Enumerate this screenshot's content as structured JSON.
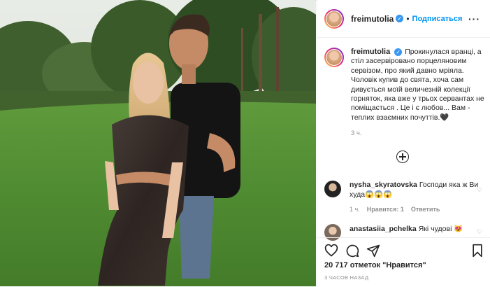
{
  "post": {
    "username": "freimutolia",
    "verified_glyph": "✓",
    "follow_label": "Подписаться",
    "more_label": "···",
    "caption": "Прокинулася вранці, а стіл засервіровано порцеляновим сервізом, про який давно мріяла. Чоловік купив до свята, хоча сам дивується моїй величезній колекції горняток, яка вже у трьох сервантах не поміщається . Це і є любов... Вам - теплих взаємних почуттів.🖤",
    "caption_time": "3 ч.",
    "load_more_icon": "plus-circle-icon"
  },
  "comments": [
    {
      "username": "nysha_skyratovska",
      "text": "Господи яка ж Ви худа😱😱😱",
      "time": "1 ч.",
      "likes": "Нравится: 1",
      "reply": "Ответить"
    },
    {
      "username": "anastasiia_pchelka",
      "text": "Які чудові 😻"
    }
  ],
  "actions": {
    "icons": [
      "heart-icon",
      "comment-icon",
      "share-icon",
      "bookmark-icon"
    ],
    "likes": "20 717 отметок \"Нравится\"",
    "posted": "3 ЧАСОВ НАЗАД"
  },
  "colors": {
    "link_blue": "#0095f6",
    "verified": "#3897f0",
    "muted": "#8e8e8e",
    "text": "#262626"
  }
}
